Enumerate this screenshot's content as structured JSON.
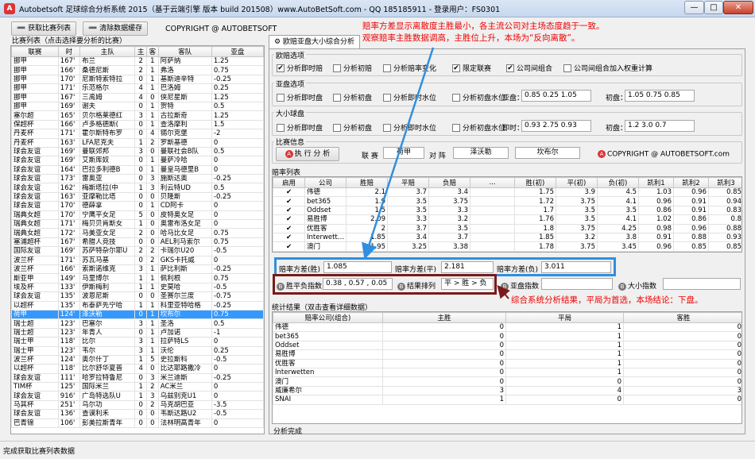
{
  "window": {
    "title": "Autobetsoft 足球综合分析系统 2015（基于云端引擎 版本 build 201508）www.AutoBetSoft.com - QQ 185185911 - 登录用户：FS0301",
    "min": "—",
    "max": "□",
    "close": "✕"
  },
  "toolbar": {
    "fetch_label": "获取比赛列表",
    "clear_label": "清除数据缓存",
    "copyright": "COPYRIGHT @ AUTOBETSOFT"
  },
  "annotations": {
    "top_line1": "赔率方差显示离散度主胜最小，各主流公司对主场态度趋于一致。",
    "top_line2": "观察赔率主胜数据调高，主胜位上升，本场为“反向离散”。",
    "bottom": "综合系统分析结果，平局为首选，本场结论：下盘。"
  },
  "left_panel": {
    "caption": "比赛列表（点击选择要分析的比赛）",
    "columns": [
      "联赛",
      "时",
      "主队",
      "主",
      "客",
      "客队",
      "亚盘"
    ],
    "rows": [
      [
        "挪甲",
        "167'",
        "布兰",
        "2",
        "1",
        "阿萨纳",
        "1.25"
      ],
      [
        "挪甲",
        "166'",
        "桑德尼斯",
        "2",
        "1",
        "弗洛",
        "0.75"
      ],
      [
        "挪甲",
        "170'",
        "尼斯特索特拉",
        "0",
        "1",
        "基斯迪辛特",
        "-0.25"
      ],
      [
        "挪甲",
        "171'",
        "乐范格尔",
        "4",
        "1",
        "巴洛姆",
        "0.25"
      ],
      [
        "挪甲",
        "167'",
        "三禹姆",
        "4",
        "0",
        "侠尼星斯",
        "1.25"
      ],
      [
        "挪甲",
        "169'",
        "谢夫",
        "0",
        "1",
        "贺特",
        "0.5"
      ],
      [
        "塞尔超",
        "165'",
        "贝尔格莱德红",
        "3",
        "1",
        "古拉斯奇",
        "1.25"
      ],
      [
        "保超杯",
        "166'",
        "卢多格德斯(",
        "0",
        "1",
        "查洛摩利",
        "1.5"
      ],
      [
        "丹麦杯",
        "171'",
        "霍尔斯特布罗",
        "0",
        "4",
        "锡尔克堡",
        "-2"
      ],
      [
        "丹麦杯",
        "163'",
        "LFA尼克夫",
        "1",
        "2",
        "罗斯基德",
        "0"
      ],
      [
        "球会友谊",
        "169'",
        "曼联郊邦",
        "3",
        "0",
        "曼联社会B队",
        "0.5"
      ],
      [
        "球会友谊",
        "169'",
        "艾斯库奴",
        "0",
        "1",
        "曼萨冷哈",
        "0"
      ],
      [
        "球会友谊",
        "164'",
        "巴拉多利德B",
        "0",
        "1",
        "曼皇马德里B",
        "0"
      ],
      [
        "球会友谊",
        "173'",
        "雷奥亚",
        "0",
        "3",
        "施斯达奥",
        "-0.25"
      ],
      [
        "球会友谊",
        "162'",
        "梅斯塔拉(中",
        "1",
        "3",
        "利云特UD",
        "0.5"
      ],
      [
        "球会友谊",
        "163'",
        "亚摩勒比塔",
        "0",
        "0",
        "贝隆斯",
        "-0.25"
      ],
      [
        "球会友谊",
        "170'",
        "德薛拿",
        "0",
        "1",
        "CD阿卡",
        "0"
      ],
      [
        "瑞典女超",
        "170'",
        "宁鹰平女足",
        "5",
        "0",
        "皮特奥女足",
        "0"
      ],
      [
        "瑞典女超",
        "171'",
        "梅贝贝肯斯女",
        "1",
        "0",
        "奥雷布洛女足",
        "0"
      ],
      [
        "瑞典女超",
        "172'",
        "马美亚女足",
        "2",
        "0",
        "哈马比女足",
        "0.75"
      ],
      [
        "塞浦超杯",
        "167'",
        "希腊人竞技",
        "0",
        "0",
        "AEL利马索尔",
        "0.75"
      ],
      [
        "国际友谊",
        "169'",
        "苏萨特杂尔耶U",
        "2",
        "2",
        "卡瑞尔U20",
        "-0.5"
      ],
      [
        "波兰杯",
        "171'",
        "苏瓦马基",
        "0",
        "2",
        "GKS卡托威",
        "0"
      ],
      [
        "波兰杯",
        "166'",
        "索斯诺维克",
        "3",
        "1",
        "萨比利斯",
        "-0.25"
      ],
      [
        "斯亚甲",
        "149'",
        "马里博尔",
        "1",
        "1",
        "佩利根",
        "0.75"
      ],
      [
        "埃及杯",
        "133'",
        "伊斯梅利",
        "1",
        "1",
        "史莫哈",
        "-0.5"
      ],
      [
        "球会友谊",
        "135'",
        "波恩尼斯",
        "0",
        "0",
        "圣赛尔兰度",
        "-0.75"
      ],
      [
        "以超杯",
        "135'",
        "布泰萨先宁哈",
        "1",
        "1",
        "科里亚特哈格",
        "-0.25"
      ],
      [
        "荷甲",
        "124'",
        "泽沃勒",
        "0",
        "1",
        "坎布尔",
        "0.75"
      ],
      [
        "瑞士超",
        "123'",
        "巴塞尔",
        "3",
        "1",
        "圣洛",
        "0.5"
      ],
      [
        "瑞士超",
        "123'",
        "年青人",
        "0",
        "1",
        "卢加诺",
        "-1"
      ],
      [
        "瑞士甲",
        "118'",
        "比尔",
        "3",
        "1",
        "拉萨特LS",
        "0"
      ],
      [
        "瑞士甲",
        "123'",
        "韦尔",
        "3",
        "1",
        "沃伦",
        "0.25"
      ],
      [
        "波兰杯",
        "124'",
        "奥尔什丁",
        "1",
        "5",
        "史拉斯科",
        "-0.5"
      ],
      [
        "以超杯",
        "118'",
        "比尔舒华夏普",
        "4",
        "0",
        "比达耶路撒冷",
        "0"
      ],
      [
        "球会友谊",
        "111'",
        "哈罗拉特鲁尼",
        "0",
        "3",
        "米兰迪斯",
        "-0.25"
      ],
      [
        "TIM杯",
        "125'",
        "国际米兰",
        "1",
        "2",
        "AC米兰",
        "0"
      ],
      [
        "球会友谊",
        "916'",
        "广岛特选队U",
        "1",
        "3",
        "乌兹别克U1",
        "0"
      ],
      [
        "马其杯",
        "251'",
        "乌尔功",
        "0",
        "2",
        "马克胡巴亚",
        "-3.5"
      ],
      [
        "球会友谊",
        "136'",
        "查谟利禾",
        "0",
        "0",
        "韦斯达路U2",
        "-0.5"
      ],
      [
        "巴青锦",
        "106'",
        "彭美拉斯青年",
        "0",
        "0",
        "法林明高青年",
        "0"
      ]
    ]
  },
  "tab": {
    "label": "欧赔亚盘大小综合分析"
  },
  "euro_options": {
    "title": "欧赔选项",
    "items": [
      {
        "label": "分析即时赔",
        "checked": true
      },
      {
        "label": "分析初赔",
        "checked": false
      },
      {
        "label": "分析赔率变化",
        "checked": false
      },
      {
        "label": "限定联赛",
        "checked": true
      },
      {
        "label": "公司间组合",
        "checked": true
      },
      {
        "label": "公司间组合加入权重计算",
        "checked": false
      }
    ]
  },
  "asia_options": {
    "title": "亚盘选项",
    "items": [
      {
        "label": "分析即时盘",
        "checked": false
      },
      {
        "label": "分析初盘",
        "checked": false
      },
      {
        "label": "分析即时水位",
        "checked": false
      },
      {
        "label": "分析初盘水位",
        "checked": false
      }
    ],
    "live_label": "亚盘：",
    "live_value": "0.85  0.25  1.05",
    "init_label": "初盘：",
    "init_value": "1.05  0.75  0.85"
  },
  "size_options": {
    "title": "大小球盘",
    "items": [
      {
        "label": "分析即时盘",
        "checked": false
      },
      {
        "label": "分析初盘",
        "checked": false
      },
      {
        "label": "分析即时水位",
        "checked": false
      },
      {
        "label": "分析初盘水位",
        "checked": false
      }
    ],
    "live_label": "即时：",
    "live_value": "0.93  2.75  0.93",
    "init_label": "初盘：",
    "init_value": "1.2  3.0  0.7"
  },
  "match_info": {
    "title": "比赛信息",
    "run_label": "执 行 分 析",
    "league_label": "联 赛",
    "league": "荷甲",
    "vs_label": "对 阵",
    "home": "泽沃勒",
    "away": "坎布尔",
    "copyright": "COPYRIGHT @ AUTOBETSOFT.com"
  },
  "odds": {
    "title": "赔率列表",
    "columns": [
      "启用",
      "公司",
      "胜赔",
      "平赔",
      "负赔",
      "...",
      "胜(初)",
      "平(初)",
      "负(初)",
      "凯利1",
      "凯利2",
      "凯利3"
    ],
    "rows": [
      [
        "✔",
        "伟德",
        "2.1",
        "3.7",
        "3.4",
        "",
        "1.75",
        "3.9",
        "4.5",
        "1.03",
        "0.96",
        "0.85"
      ],
      [
        "✔",
        "bet365",
        "1.9",
        "3.5",
        "3.75",
        "",
        "1.72",
        "3.75",
        "4.1",
        "0.96",
        "0.91",
        "0.94"
      ],
      [
        "✔",
        "Oddset",
        "1.5",
        "3.5",
        "3.3",
        "",
        "1.7",
        "3.5",
        "3.5",
        "0.86",
        "0.91",
        "0.83"
      ],
      [
        "✔",
        "易胜博",
        "2.09",
        "3.3",
        "3.2",
        "",
        "1.76",
        "3.5",
        "4.1",
        "1.02",
        "0.86",
        "0.8"
      ],
      [
        "✔",
        "优胜客",
        "2",
        "3.7",
        "3.5",
        "",
        "1.8",
        "3.75",
        "4.25",
        "0.98",
        "0.96",
        "0.88"
      ],
      [
        "✔",
        "Interwett…",
        "1.85",
        "3.4",
        "3.7",
        "",
        "1.85",
        "3.2",
        "3.8",
        "0.91",
        "0.88",
        "0.93"
      ],
      [
        "✔",
        "澳门",
        "1.95",
        "3.25",
        "3.38",
        "",
        "1.78",
        "3.75",
        "3.45",
        "0.96",
        "0.85",
        "0.85"
      ]
    ]
  },
  "variance": {
    "home_label": "赔率方差(胜)",
    "home_value": "1.085",
    "draw_label": "赔率方差(平)",
    "draw_value": "2.181",
    "away_label": "赔率方差(负)",
    "away_value": "3.011"
  },
  "indicators": {
    "wdl_label": "胜平负指数",
    "wdl_value": "0.38 , 0.57 , 0.05",
    "rank_label": "结果排列",
    "rank_value": "平 > 胜 > 负",
    "asia_label": "亚盘指数",
    "asia_value": "",
    "size_label": "大小指数",
    "size_value": ""
  },
  "stats": {
    "title": "统计结果（双击查看详细数据）",
    "columns": [
      "赔率公司(组合)",
      "主胜",
      "平局",
      "客胜"
    ],
    "rows": [
      [
        "伟德",
        "0",
        "1",
        "0"
      ],
      [
        "bet365",
        "0",
        "1",
        "0"
      ],
      [
        "Oddset",
        "0",
        "1",
        "0"
      ],
      [
        "易胜博",
        "0",
        "1",
        "0"
      ],
      [
        "优胜客",
        "0",
        "1",
        "0"
      ],
      [
        "Interwetten",
        "0",
        "1",
        "0"
      ],
      [
        "澳门",
        "0",
        "0",
        "0"
      ],
      [
        "威廉希尔",
        "3",
        "4",
        "3"
      ],
      [
        "SNAI",
        "1",
        "0",
        "0"
      ]
    ]
  },
  "status": {
    "inner": "分析完成",
    "outer": "完成获取比赛列表数据"
  }
}
